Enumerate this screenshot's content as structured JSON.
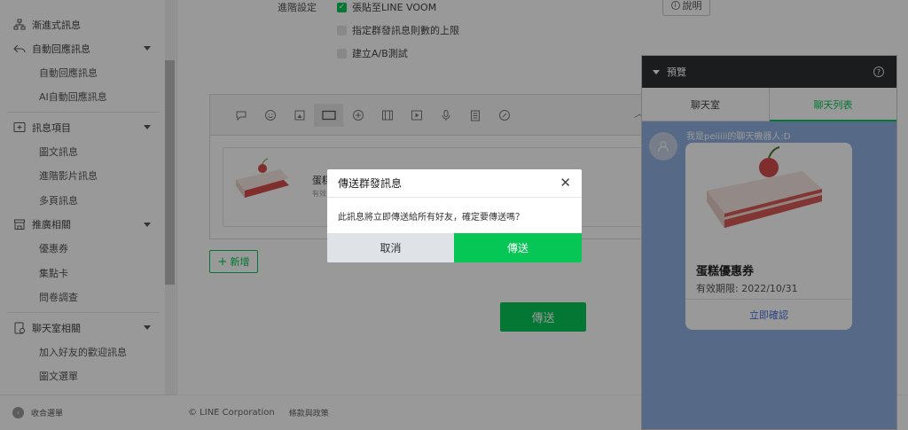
{
  "sidebar": {
    "items": [
      {
        "type": "group",
        "label": "漸進式訊息",
        "icon": "hierarchy-icon"
      },
      {
        "type": "group",
        "label": "自動回應訊息",
        "icon": "reply-icon",
        "caret": true
      },
      {
        "type": "sub",
        "label": "自動回應訊息"
      },
      {
        "type": "sub",
        "label": "AI自動回應訊息"
      },
      {
        "type": "divider"
      },
      {
        "type": "group",
        "label": "訊息項目",
        "icon": "message-plus-icon",
        "caret": true
      },
      {
        "type": "sub",
        "label": "圖文訊息"
      },
      {
        "type": "sub",
        "label": "進階影片訊息"
      },
      {
        "type": "sub",
        "label": "多頁訊息"
      },
      {
        "type": "group",
        "label": "推廣相關",
        "icon": "store-icon",
        "caret": true
      },
      {
        "type": "sub",
        "label": "優惠券"
      },
      {
        "type": "sub",
        "label": "集點卡"
      },
      {
        "type": "sub",
        "label": "問卷調查"
      },
      {
        "type": "divider"
      },
      {
        "type": "group",
        "label": "聊天室相關",
        "icon": "chat-room-icon",
        "caret": true
      },
      {
        "type": "sub",
        "label": "加入好友的歡迎訊息"
      },
      {
        "type": "sub",
        "label": "圖文選單"
      }
    ],
    "collapse_label": "收合選單"
  },
  "settings": {
    "advanced_label": "進階設定",
    "options": [
      {
        "label": "張貼至LINE VOOM",
        "checked": true
      },
      {
        "label": "指定群發訊息則數的上限",
        "checked": false
      },
      {
        "label": "建立A/B測試",
        "checked": false
      }
    ],
    "help_label": "說明"
  },
  "editor": {
    "toolbar_icons": [
      "speech-bubble-icon",
      "emoji-icon",
      "sticker-icon",
      "card-icon",
      "coupon-icon",
      "rich-message-icon",
      "video-icon",
      "mic-icon",
      "survey-icon",
      "link-icon"
    ],
    "card_title": "蛋糕",
    "card_sub": "有效"
  },
  "add_label": "新增",
  "send_label": "傳送",
  "footer": {
    "copyright": "© LINE Corporation",
    "terms": "條款與政策"
  },
  "preview": {
    "title": "預覽",
    "tabs": [
      "聊天室",
      "聊天列表"
    ],
    "bot_name": "我是peiiiii的聊天機器人:D",
    "coupon_title": "蛋糕優惠券",
    "coupon_date": "有效期限: 2022/10/31",
    "coupon_link": "立即確認"
  },
  "dialog": {
    "title": "傳送群發訊息",
    "body": "此訊息將立即傳送給所有好友，確定要傳送嗎？",
    "cancel": "取消",
    "send": "傳送"
  },
  "colors": {
    "accent": "#06c755",
    "preview_bg": "#8fb0e0",
    "preview_header": "#2c2f33"
  }
}
